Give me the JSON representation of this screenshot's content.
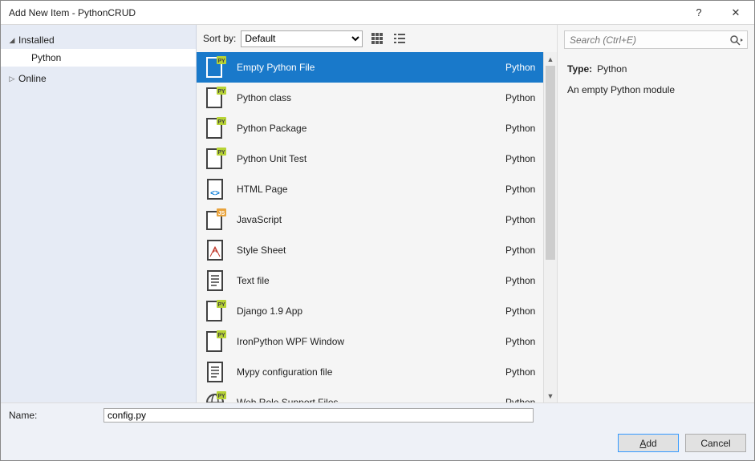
{
  "title": "Add New Item - PythonCRUD",
  "sidebar": {
    "nodes": [
      {
        "label": "Installed",
        "expanded": true,
        "children": [
          {
            "label": "Python",
            "selected": true
          }
        ]
      },
      {
        "label": "Online",
        "expanded": false
      }
    ]
  },
  "sort": {
    "label": "Sort by:",
    "options": [
      "Default"
    ],
    "value": "Default"
  },
  "search": {
    "placeholder": "Search (Ctrl+E)"
  },
  "templates": [
    {
      "name": "Empty Python File",
      "lang": "Python",
      "selected": true,
      "icon": "py-file"
    },
    {
      "name": "Python class",
      "lang": "Python",
      "icon": "py-file"
    },
    {
      "name": "Python Package",
      "lang": "Python",
      "icon": "py-package"
    },
    {
      "name": "Python Unit Test",
      "lang": "Python",
      "icon": "py-file"
    },
    {
      "name": "HTML Page",
      "lang": "Python",
      "icon": "html"
    },
    {
      "name": "JavaScript",
      "lang": "Python",
      "icon": "js"
    },
    {
      "name": "Style Sheet",
      "lang": "Python",
      "icon": "css"
    },
    {
      "name": "Text file",
      "lang": "Python",
      "icon": "text"
    },
    {
      "name": "Django 1.9 App",
      "lang": "Python",
      "icon": "django"
    },
    {
      "name": "IronPython WPF Window",
      "lang": "Python",
      "icon": "wpf"
    },
    {
      "name": "Mypy configuration file",
      "lang": "Python",
      "icon": "text"
    },
    {
      "name": "Web Role Support Files",
      "lang": "Python",
      "icon": "web"
    }
  ],
  "details": {
    "type_label": "Type:",
    "type_value": "Python",
    "description": "An empty Python module"
  },
  "footer": {
    "name_label": "Name:",
    "name_value": "config.py",
    "add_label": "Add",
    "cancel_label": "Cancel"
  }
}
